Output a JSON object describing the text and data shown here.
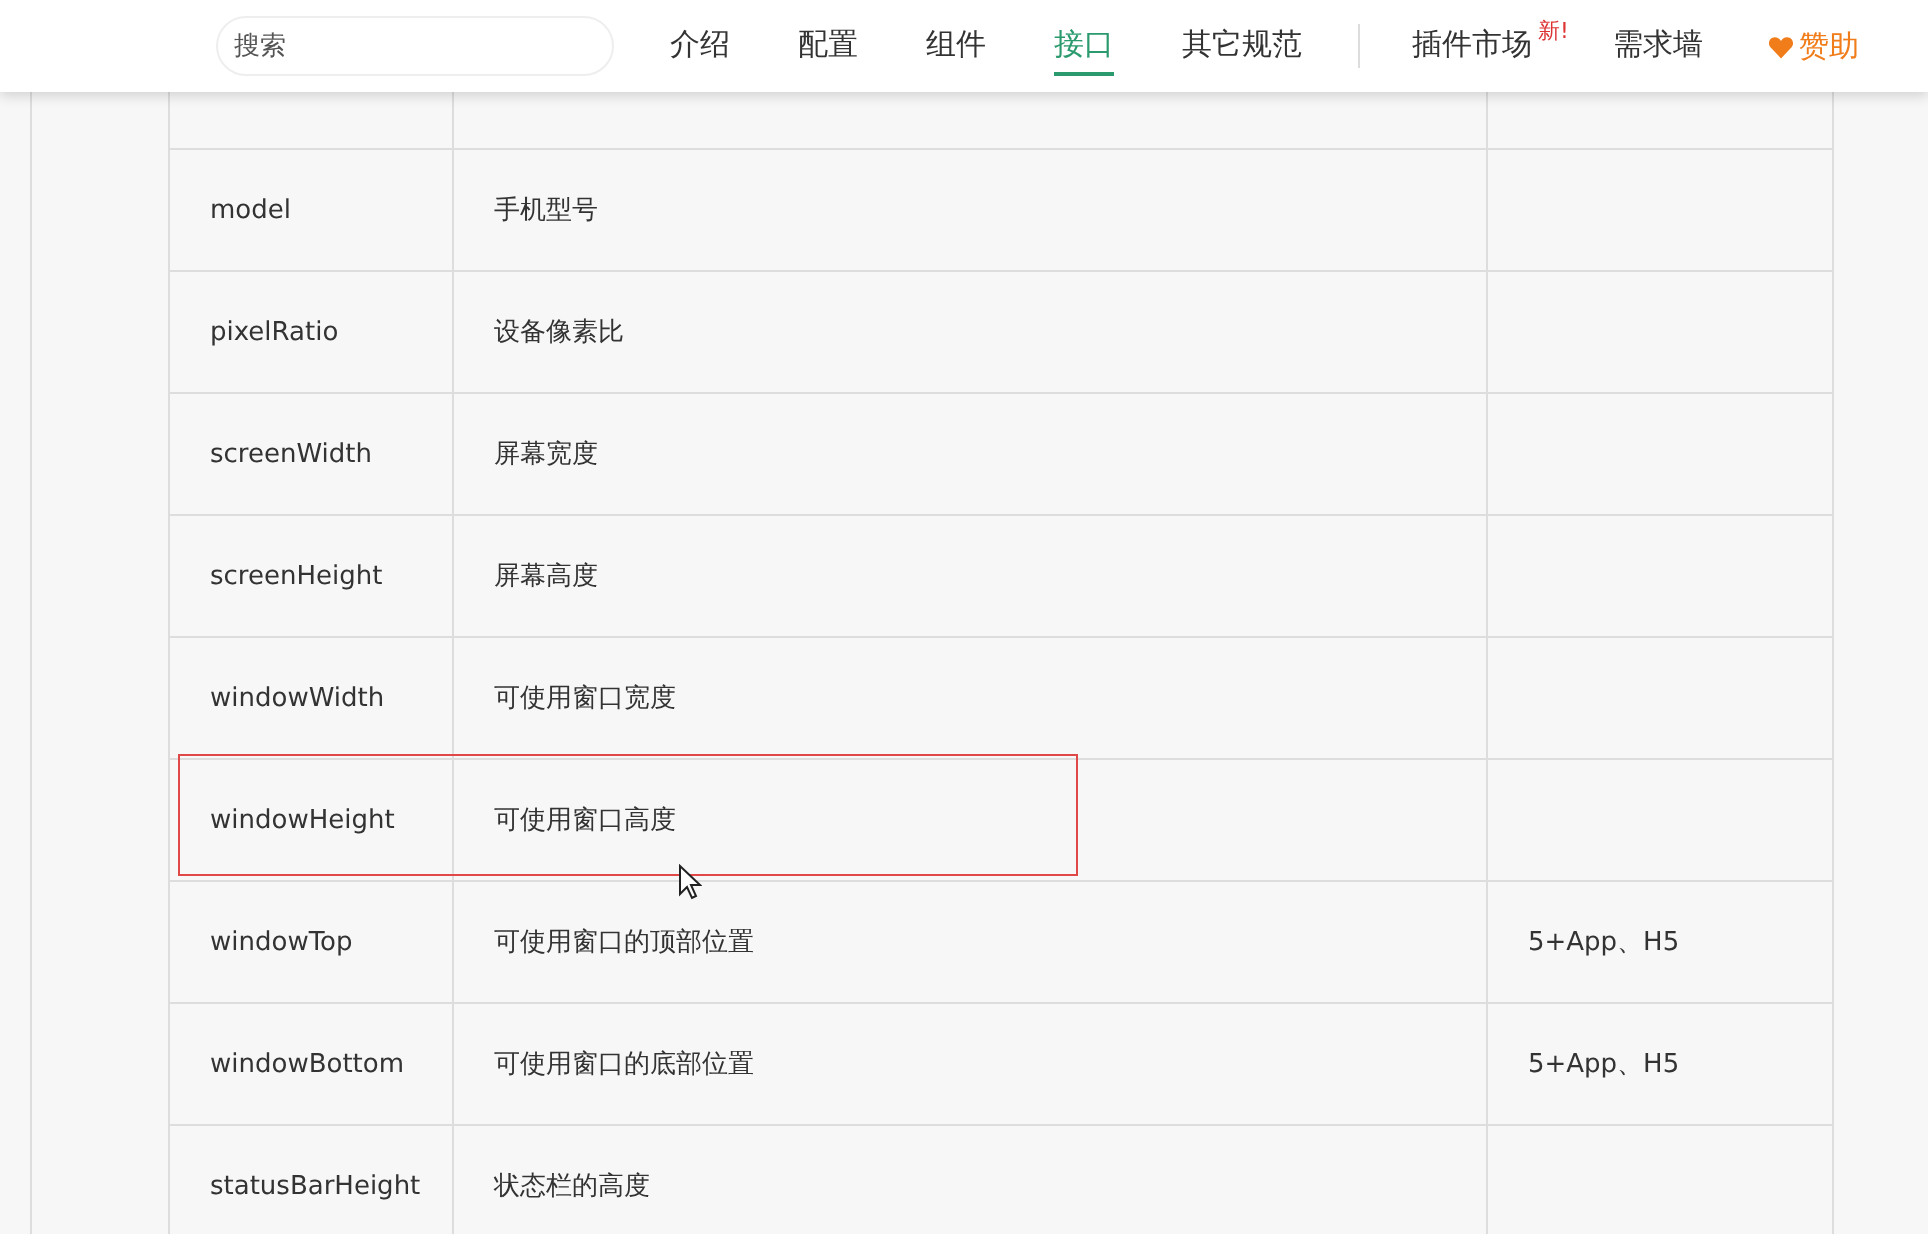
{
  "header": {
    "search": {
      "placeholder": "搜索"
    },
    "nav": [
      {
        "label": "介绍",
        "selected": false
      },
      {
        "label": "配置",
        "selected": false
      },
      {
        "label": "组件",
        "selected": false
      },
      {
        "label": "接口",
        "selected": true
      },
      {
        "label": "其它规范",
        "selected": false
      }
    ],
    "market": {
      "label": "插件市场",
      "badge": "新!"
    },
    "wall": "需求墙",
    "sponsor": "赞助"
  },
  "table": {
    "rows": [
      {
        "name": "model",
        "desc": "手机型号",
        "platform": ""
      },
      {
        "name": "pixelRatio",
        "desc": "设备像素比",
        "platform": ""
      },
      {
        "name": "screenWidth",
        "desc": "屏幕宽度",
        "platform": ""
      },
      {
        "name": "screenHeight",
        "desc": "屏幕高度",
        "platform": ""
      },
      {
        "name": "windowWidth",
        "desc": "可使用窗口宽度",
        "platform": ""
      },
      {
        "name": "windowHeight",
        "desc": "可使用窗口高度",
        "platform": "",
        "highlighted": true
      },
      {
        "name": "windowTop",
        "desc": "可使用窗口的顶部位置",
        "platform": "5+App、H5"
      },
      {
        "name": "windowBottom",
        "desc": "可使用窗口的底部位置",
        "platform": "5+App、H5"
      },
      {
        "name": "statusBarHeight",
        "desc": "状态栏的高度",
        "platform": ""
      }
    ]
  }
}
